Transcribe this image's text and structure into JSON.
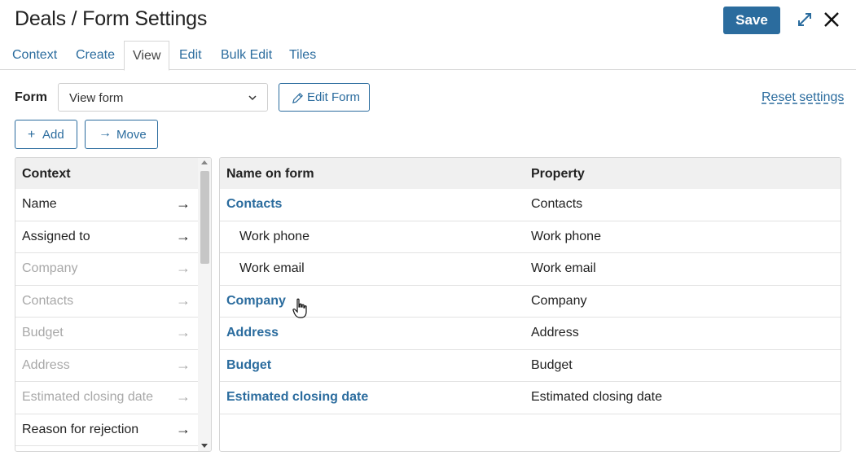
{
  "header": {
    "title": "Deals / Form Settings",
    "save_label": "Save",
    "expand_icon": "expand-icon",
    "close_icon": "close-icon"
  },
  "tabs": [
    {
      "label": "Context",
      "active": false
    },
    {
      "label": "Create",
      "active": false
    },
    {
      "label": "View",
      "active": true
    },
    {
      "label": "Edit",
      "active": false
    },
    {
      "label": "Bulk Edit",
      "active": false
    },
    {
      "label": "Tiles",
      "active": false
    }
  ],
  "toolbar": {
    "form_label": "Form",
    "form_select_value": "View form",
    "edit_form_label": "Edit Form",
    "reset_label": "Reset settings",
    "add_label": "Add",
    "add_icon": "+",
    "move_label": "Move",
    "move_icon": "→"
  },
  "context_panel": {
    "header": "Context",
    "rows": [
      {
        "label": "Name",
        "enabled": true,
        "arrow": "→"
      },
      {
        "label": "Assigned to",
        "enabled": true,
        "arrow": "→"
      },
      {
        "label": "Company",
        "enabled": false,
        "arrow": "→"
      },
      {
        "label": "Contacts",
        "enabled": false,
        "arrow": "→"
      },
      {
        "label": "Budget",
        "enabled": false,
        "arrow": "→"
      },
      {
        "label": "Address",
        "enabled": false,
        "arrow": "→"
      },
      {
        "label": "Estimated closing date",
        "enabled": false,
        "arrow": "→"
      },
      {
        "label": "Reason for rejection",
        "enabled": true,
        "arrow": "→"
      }
    ]
  },
  "fields_panel": {
    "col_name": "Name on form",
    "col_property": "Property",
    "rows": [
      {
        "name": "Contacts",
        "property": "Contacts",
        "kind": "group"
      },
      {
        "name": "Work phone",
        "property": "Work phone",
        "kind": "child"
      },
      {
        "name": "Work email",
        "property": "Work email",
        "kind": "child"
      },
      {
        "name": "Company",
        "property": "Company",
        "kind": "group"
      },
      {
        "name": "Address",
        "property": "Address",
        "kind": "group"
      },
      {
        "name": "Budget",
        "property": "Budget",
        "kind": "group"
      },
      {
        "name": "Estimated closing date",
        "property": "Estimated closing date",
        "kind": "group"
      }
    ]
  },
  "colors": {
    "accent": "#2b6c9e",
    "disabled_text": "#a8a8a8",
    "header_bg": "#f0f0f0"
  }
}
